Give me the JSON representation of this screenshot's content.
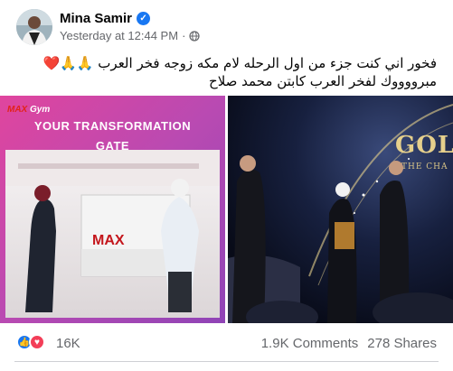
{
  "post": {
    "author": "Mina Samir",
    "timestamp": "Yesterday at 12:44 PM",
    "separator": "·",
    "privacy_icon": "globe-icon",
    "verified_icon": "verified-badge-icon",
    "text_line1": "فخور اني كنت جزء من اول الرحله لام مكه زوجه فخر العرب 🙏🙏❤️",
    "text_line2": "مبرووووك لفخر العرب كابتن محمد صلاح"
  },
  "photos": {
    "left": {
      "logo_brand": "MAX",
      "logo_suffix": "Gym",
      "banner_title_line1": "YOUR TRANSFORMATION",
      "banner_title_line2": "GATE",
      "desk_logo": "MAX"
    },
    "right": {
      "backdrop_text": "GOL",
      "backdrop_sub": "THE CHA"
    }
  },
  "stats": {
    "reactions_count": "16K",
    "comments": "1.9K Comments",
    "shares": "278 Shares",
    "reaction_icons": [
      "like-icon",
      "love-icon"
    ]
  },
  "colors": {
    "facebook_blue": "#1877f2",
    "love_red": "#f33e58",
    "secondary_text": "#65676b",
    "banner_purple": "#a63fa7"
  }
}
